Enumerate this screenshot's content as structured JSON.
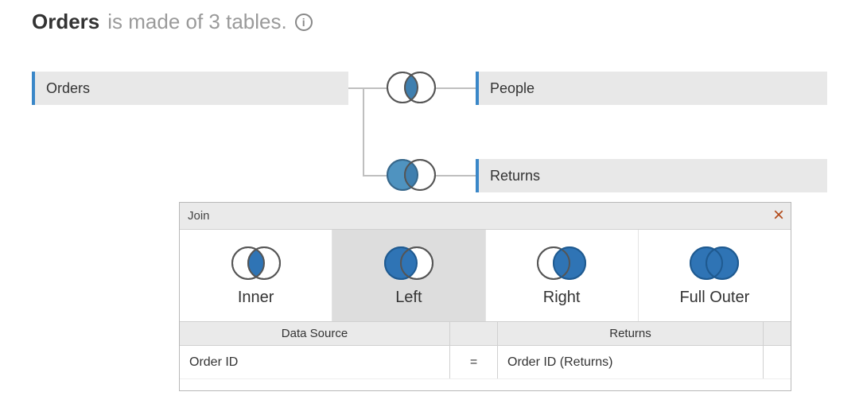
{
  "header": {
    "title": "Orders",
    "subtitle": "is made of 3 tables.",
    "info_glyph": "i"
  },
  "tables": {
    "orders": "Orders",
    "people": "People",
    "returns": "Returns"
  },
  "join_dialog": {
    "title": "Join",
    "options": {
      "inner": "Inner",
      "left": "Left",
      "right": "Right",
      "full_outer": "Full Outer"
    },
    "selected": "left",
    "clause_headers": {
      "left": "Data Source",
      "right": "Returns"
    },
    "clause": {
      "left_field": "Order ID",
      "operator": "=",
      "right_field": "Order ID (Returns)"
    }
  }
}
